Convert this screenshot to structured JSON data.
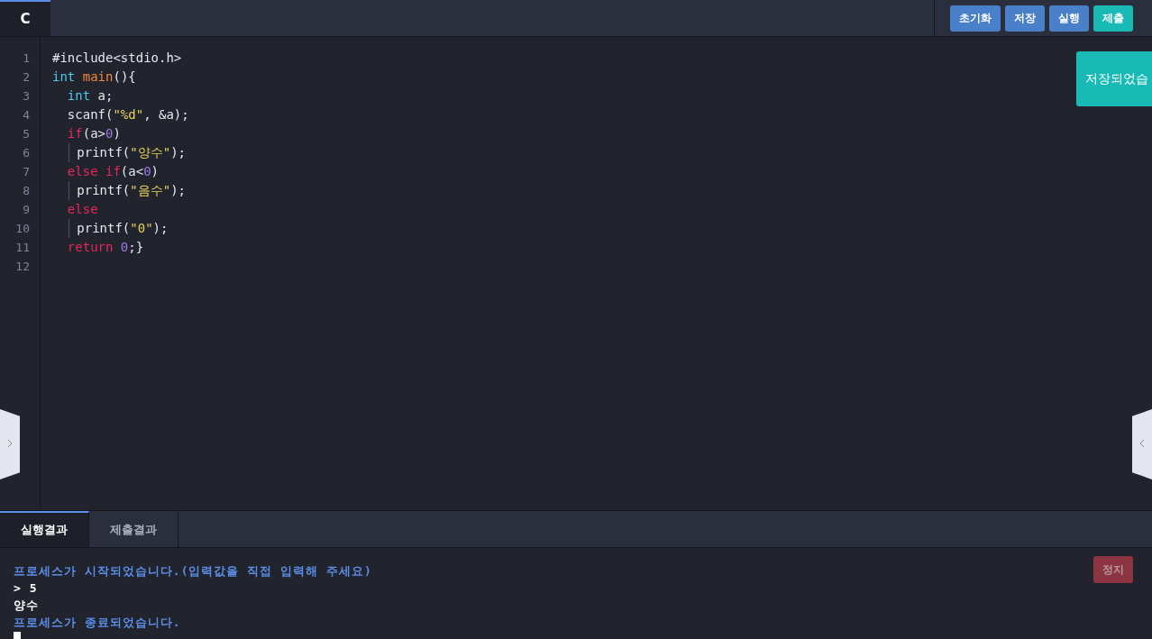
{
  "editor_tabs": [
    {
      "label": "C",
      "selected": true
    }
  ],
  "toolbar": [
    {
      "label": "초기화",
      "kind": "primary"
    },
    {
      "label": "저장",
      "kind": "primary"
    },
    {
      "label": "실행",
      "kind": "primary"
    },
    {
      "label": "제출",
      "kind": "accent"
    }
  ],
  "toast": {
    "message": "저장되었습"
  },
  "code_lines": [
    {
      "number": "1",
      "tokens": [
        {
          "kind": "plain",
          "text": "#include<stdio.h>"
        }
      ]
    },
    {
      "number": "2",
      "tokens": [
        {
          "kind": "type",
          "text": "int"
        },
        {
          "kind": "func",
          "text": " main"
        },
        {
          "kind": "plain",
          "text": "(){"
        }
      ]
    },
    {
      "number": "3",
      "tokens": [
        {
          "kind": "type",
          "text": "  int"
        },
        {
          "kind": "plain",
          "text": " a;"
        }
      ]
    },
    {
      "number": "4",
      "tokens": [
        {
          "kind": "plain",
          "text": "  scanf("
        },
        {
          "kind": "string",
          "text": "\"%d\""
        },
        {
          "kind": "plain",
          "text": ", &a);"
        }
      ]
    },
    {
      "number": "5",
      "tokens": [
        {
          "kind": "keyword",
          "text": "  if"
        },
        {
          "kind": "plain",
          "text": "(a>"
        },
        {
          "kind": "number",
          "text": "0"
        },
        {
          "kind": "plain",
          "text": ")"
        }
      ]
    },
    {
      "number": "6",
      "tokens": [
        {
          "kind": "guide"
        },
        {
          "kind": "plain",
          "text": " printf("
        },
        {
          "kind": "string",
          "text": "\"양수\""
        },
        {
          "kind": "plain",
          "text": ");"
        }
      ]
    },
    {
      "number": "7",
      "tokens": [
        {
          "kind": "keyword",
          "text": "  else if"
        },
        {
          "kind": "plain",
          "text": "(a<"
        },
        {
          "kind": "number",
          "text": "0"
        },
        {
          "kind": "plain",
          "text": ")"
        }
      ]
    },
    {
      "number": "8",
      "tokens": [
        {
          "kind": "guide"
        },
        {
          "kind": "plain",
          "text": " printf("
        },
        {
          "kind": "string",
          "text": "\"음수\""
        },
        {
          "kind": "plain",
          "text": ");"
        }
      ]
    },
    {
      "number": "9",
      "tokens": [
        {
          "kind": "keyword",
          "text": "  else"
        }
      ]
    },
    {
      "number": "10",
      "tokens": [
        {
          "kind": "guide"
        },
        {
          "kind": "plain",
          "text": " printf("
        },
        {
          "kind": "string",
          "text": "\"0\""
        },
        {
          "kind": "plain",
          "text": ");"
        }
      ]
    },
    {
      "number": "11",
      "tokens": [
        {
          "kind": "keyword",
          "text": "  return"
        },
        {
          "kind": "number",
          "text": " 0"
        },
        {
          "kind": "plain",
          "text": ";}"
        }
      ]
    },
    {
      "number": "12"
    }
  ],
  "result_tabs": [
    {
      "label": "실행결과",
      "selected": true
    },
    {
      "label": "제출결과",
      "selected": false
    }
  ],
  "stop_button": {
    "label": "정지",
    "disabled": true
  },
  "console_lines": [
    {
      "kind": "system",
      "text": "프로세스가 시작되었습니다.(입력값을 직접 입력해 주세요)"
    },
    {
      "kind": "output",
      "text": "> 5"
    },
    {
      "kind": "output",
      "text": "양수"
    },
    {
      "kind": "system",
      "text": "프로세스가 종료되었습니다."
    }
  ]
}
